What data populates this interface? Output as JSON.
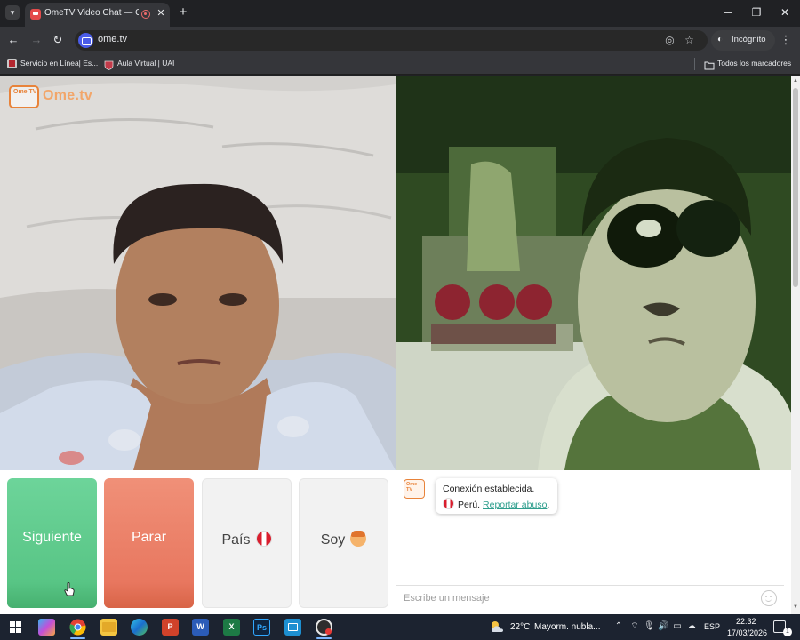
{
  "browser": {
    "tab": {
      "title": "OmeTV Video Chat — Omegle"
    },
    "url": "ome.tv",
    "incognito_label": "Incógnito",
    "bookmarks": [
      {
        "label": "Servicio en Línea| Es..."
      },
      {
        "label": "Aula Virtual | UAI"
      }
    ],
    "all_bookmarks_label": "Todos los marcadores"
  },
  "page": {
    "logo": {
      "tv_text": "Ome TV",
      "word": "Ome.tv"
    },
    "controls": {
      "next_label": "Siguiente",
      "stop_label": "Parar",
      "country_label": "País",
      "gender_label": "Soy"
    },
    "chat": {
      "avatar_text": "Ome TV",
      "status_message": "Conexión establecida.",
      "country_name": "Perú.",
      "report_link": "Reportar abuso",
      "report_suffix": ".",
      "input_placeholder": "Escribe un mensaje"
    },
    "colors": {
      "next_button": "#58c585",
      "stop_button": "#e8775f",
      "link": "#2e9e8d",
      "logo": "#e8833a"
    }
  },
  "taskbar": {
    "weather": "22°C",
    "weather_desc": "Mayorm. nubla...",
    "language": "ESP",
    "time": "22:32",
    "date": "17/03/2026",
    "notification_count": "1",
    "apps": [
      "windows-start",
      "copilot",
      "chrome",
      "file-explorer",
      "edge",
      "powerpoint",
      "word",
      "excel",
      "photoshop",
      "app-store",
      "recorder"
    ]
  }
}
